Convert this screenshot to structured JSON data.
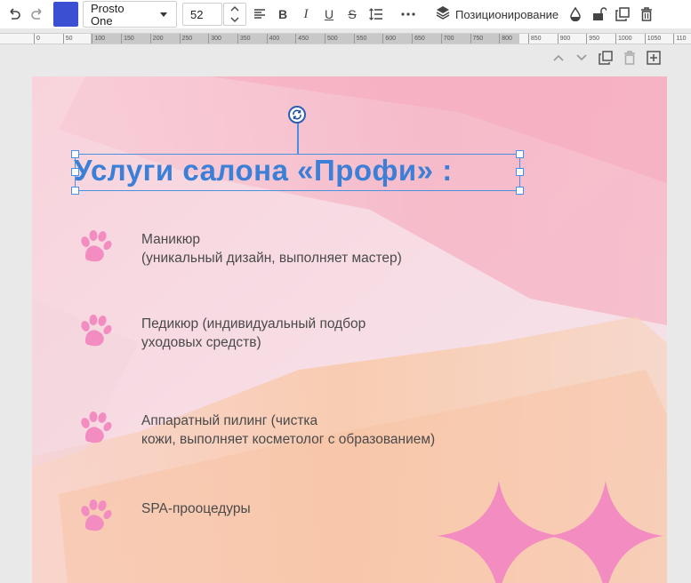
{
  "toolbar": {
    "undo_icon": "undo-icon",
    "redo_icon": "redo-icon",
    "text_color": "#3a4fd1",
    "font_family": "Prosto One",
    "font_size": "52",
    "positioning_label": "Позиционирование",
    "icons": [
      "align-left-icon",
      "bold-icon",
      "italic-icon",
      "underline-icon",
      "strikethrough-icon",
      "line-spacing-icon",
      "more-icon",
      "layers-icon",
      "opacity-icon",
      "unlock-icon",
      "duplicate-icon",
      "delete-icon"
    ]
  },
  "ruler": {
    "ticks": [
      "0",
      "50",
      "100",
      "150",
      "200",
      "250",
      "300",
      "350",
      "400",
      "450",
      "500",
      "550",
      "600",
      "650",
      "700",
      "750",
      "800",
      "850",
      "900",
      "950",
      "1000",
      "1050",
      "110"
    ]
  },
  "page_controls": [
    "chevron-up-icon",
    "chevron-down-icon",
    "duplicate-page-icon",
    "delete-page-icon",
    "add-page-icon"
  ],
  "canvas": {
    "title": "Услуги салона «Профи» :",
    "title_color": "#3b7fd6",
    "accent_pink": "#f38cc0",
    "services": [
      {
        "line1": "Маникюр",
        "line2": "(уникальный дизайн, выполняет мастер)"
      },
      {
        "line1": "Педикюр (индивидуальный подбор",
        "line2": "уходовых средств)"
      },
      {
        "line1": "Аппаратный пилинг (чистка",
        "line2": "кожи, выполняет косметолог с образованием)"
      },
      {
        "line1": "SPA-прооцедуры",
        "line2": ""
      }
    ]
  }
}
